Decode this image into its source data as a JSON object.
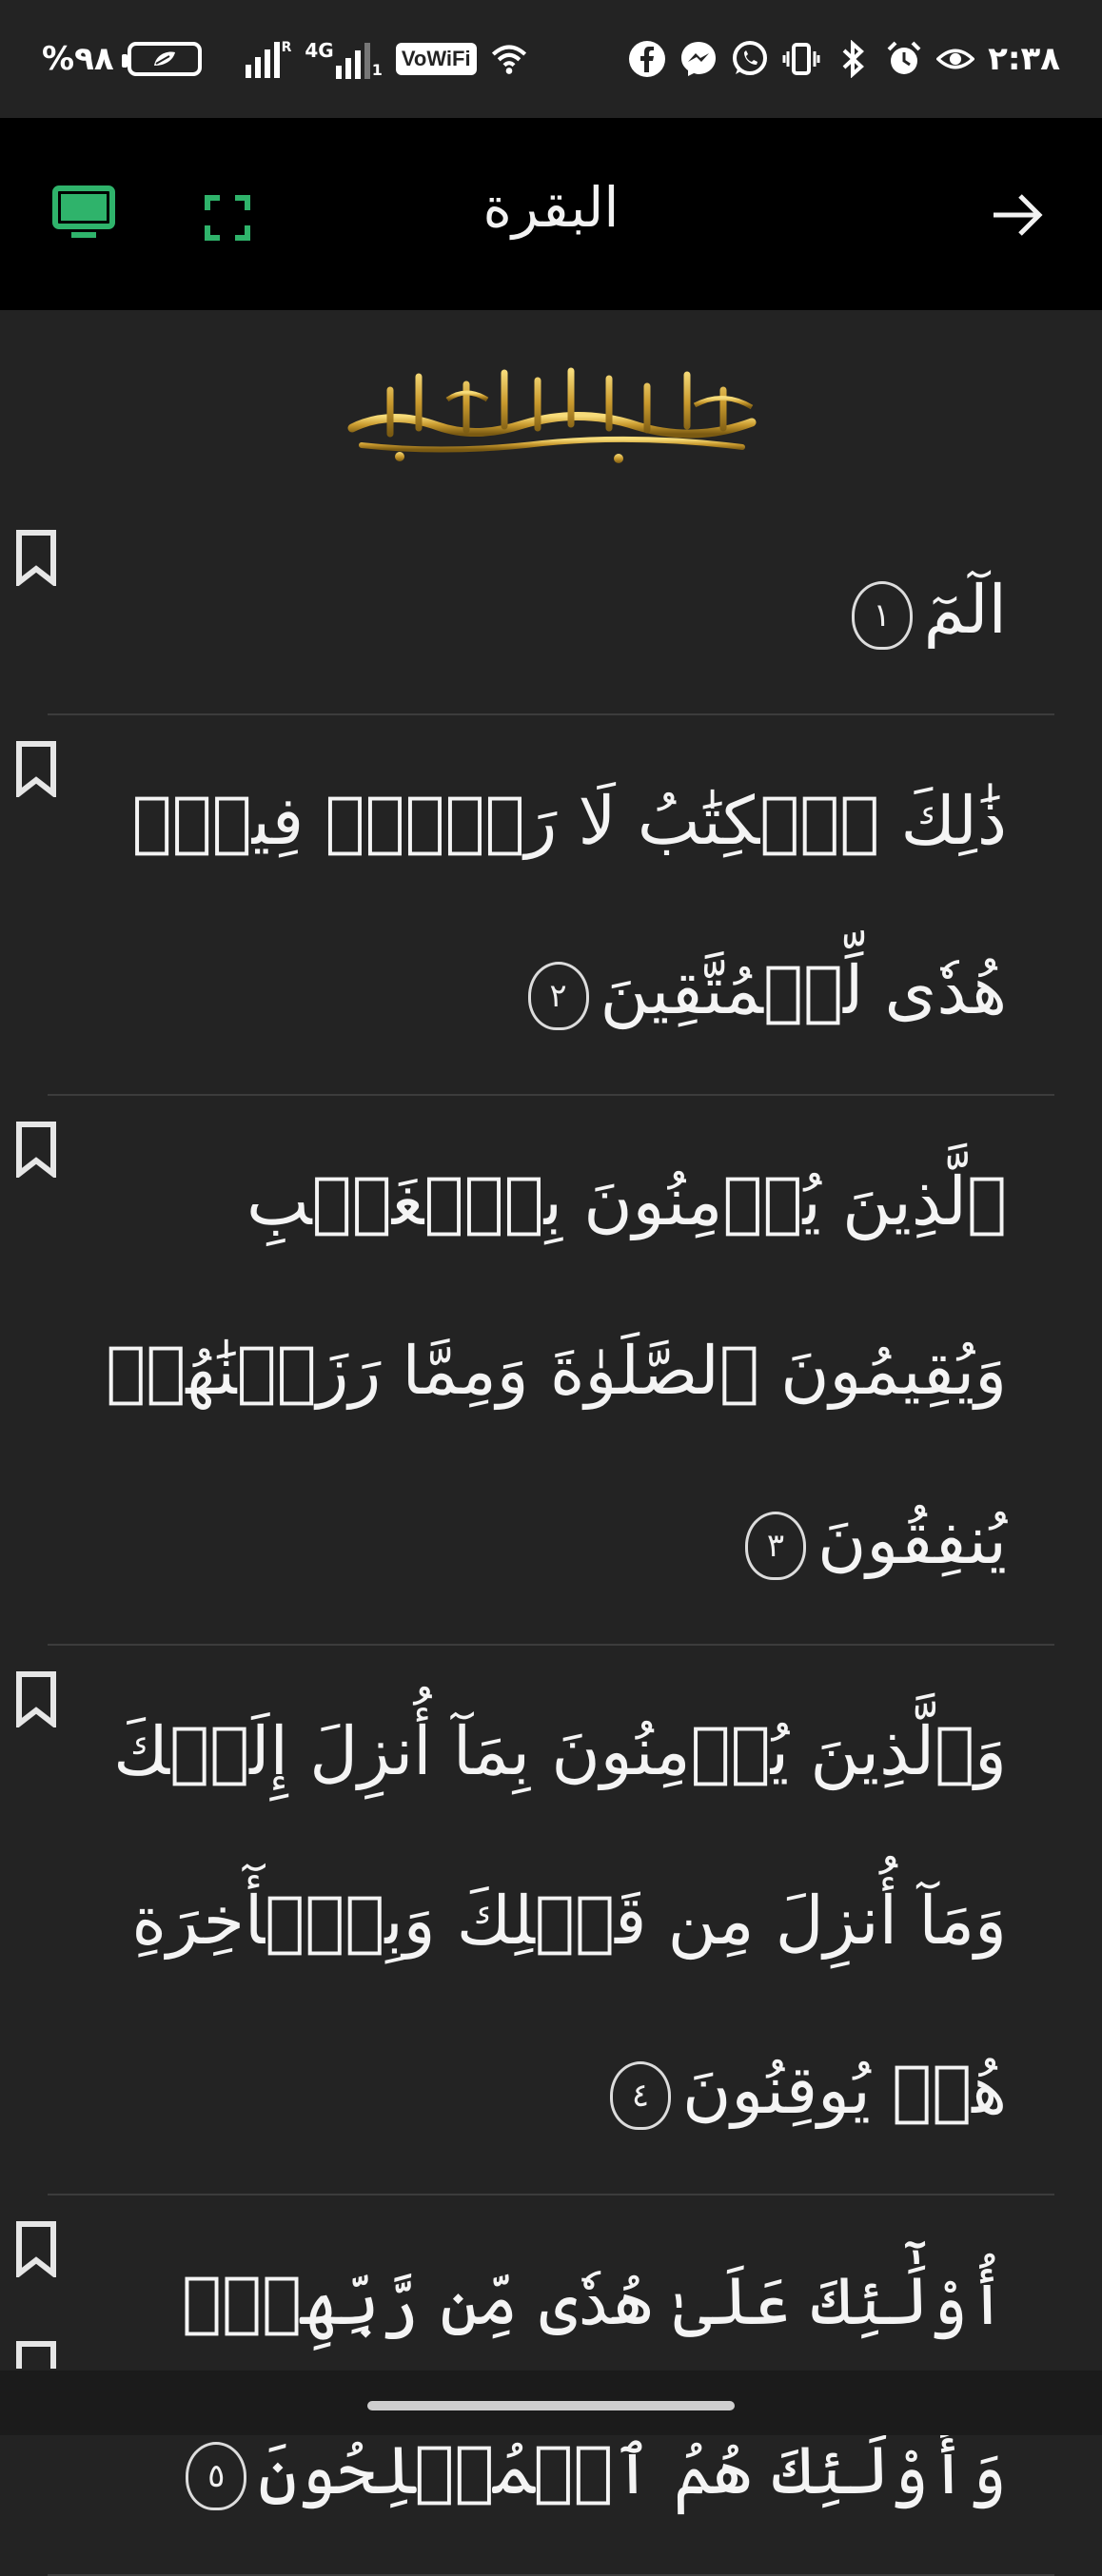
{
  "status_bar": {
    "time": "٢:٣٨",
    "battery_text": "%٩٨",
    "network_label": "4G",
    "sim_index": "1",
    "roaming_mark": "R",
    "vowifi_label": "VoWiFi",
    "icons": [
      "facebook-icon",
      "messenger-icon",
      "whatsapp-icon",
      "vibrate-icon",
      "bluetooth-icon",
      "alarm-icon",
      "eye-icon",
      "wifi-icon",
      "signal-icon",
      "battery-icon"
    ]
  },
  "toolbar": {
    "title": "البقرة",
    "accent_color": "#2fb36b"
  },
  "verses": [
    {
      "text": "الٓمٓ",
      "number": "١"
    },
    {
      "text": "ذَٰلِكَ ٱلۡكِتَٰبُ لَا رَيۡبَۛ فِيهِۛ هُدٗى لِّلۡمُتَّقِينَ",
      "number": "٢"
    },
    {
      "text": "ٱلَّذِينَ يُؤۡمِنُونَ بِٱلۡغَيۡبِ وَيُقِيمُونَ ٱلصَّلَوٰةَ وَمِمَّا رَزَقۡنَٰهُمۡ يُنفِقُونَ",
      "number": "٣"
    },
    {
      "text": "وَٱلَّذِينَ يُؤۡمِنُونَ بِمَآ أُنزِلَ إِلَيۡكَ وَمَآ أُنزِلَ مِن قَبۡلِكَ وَبِٱلۡأٓخِرَةِ هُمۡ يُوقِنُونَ",
      "number": "٤"
    },
    {
      "text": "أُوْلَٰٓئِكَ عَلَىٰ هُدٗى مِّن رَّبِّهِمۡۖ وَأُوْلَٰٓئِكَ هُمُ ٱلۡمُفۡلِحُونَ",
      "number": "٥"
    }
  ]
}
